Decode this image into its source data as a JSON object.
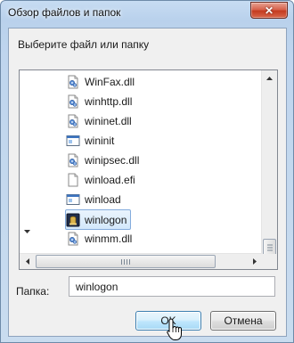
{
  "window": {
    "title": "Обзор файлов и папок",
    "close_icon": "close-icon"
  },
  "prompt": "Выберите файл или папку",
  "tree": {
    "items": [
      {
        "label": "WinFax.dll",
        "icon": "dll-file-icon",
        "selected": false
      },
      {
        "label": "winhttp.dll",
        "icon": "dll-file-icon",
        "selected": false
      },
      {
        "label": "wininet.dll",
        "icon": "dll-file-icon",
        "selected": false
      },
      {
        "label": "wininit",
        "icon": "exe-app-icon",
        "selected": false
      },
      {
        "label": "winipsec.dll",
        "icon": "dll-file-icon",
        "selected": false
      },
      {
        "label": "winload.efi",
        "icon": "blank-file-icon",
        "selected": false
      },
      {
        "label": "winload",
        "icon": "exe-app-icon",
        "selected": false
      },
      {
        "label": "winlogon",
        "icon": "winlogon-app-icon",
        "selected": true
      },
      {
        "label": "winmm.dll",
        "icon": "dll-file-icon",
        "selected": false
      }
    ]
  },
  "folder": {
    "label": "Папка:",
    "value": "winlogon"
  },
  "buttons": {
    "ok": "OK",
    "cancel": "Отмена"
  },
  "colors": {
    "selection_border": "#84acdd",
    "default_button_border": "#3c7fb1",
    "close_button": "#c43b20"
  }
}
